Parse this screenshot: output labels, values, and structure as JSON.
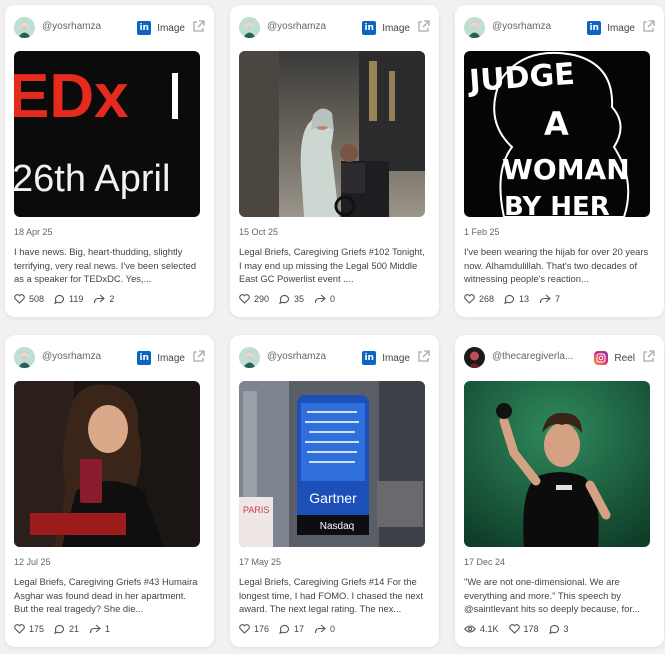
{
  "posts": [
    {
      "handle": "@yosrhamza",
      "platform": "linkedin",
      "platform_glyph": "in",
      "type_label": "Image",
      "date": "18 Apr 25",
      "image_text_line1": "EDx",
      "image_text_line2": "26th April",
      "text": "I have news. Big, heart-thudding, slightly terrifying, very real news. I've been selected as a speaker for TEDxDC. Yes,...",
      "stats": {
        "likes": "508",
        "comments": "119",
        "shares": "2"
      }
    },
    {
      "handle": "@yosrhamza",
      "platform": "linkedin",
      "platform_glyph": "in",
      "type_label": "Image",
      "date": "15 Oct 25",
      "text": "Legal Briefs, Caregiving Griefs #102 Tonight, I may end up missing the Legal 500 Middle East GC Powerlist event ....",
      "stats": {
        "likes": "290",
        "comments": "35",
        "shares": "0"
      }
    },
    {
      "handle": "@yosrhamza",
      "platform": "linkedin",
      "platform_glyph": "in",
      "type_label": "Image",
      "date": "1 Feb 25",
      "image_words": [
        "JUDGE",
        "A",
        "WOMAN",
        "BY HER"
      ],
      "text": "I've been wearing the hijab for over 20 years now. Alhamdulillah. That's two decades of witnessing people's reaction...",
      "stats": {
        "likes": "268",
        "comments": "13",
        "shares": "7"
      }
    },
    {
      "handle": "@yosrhamza",
      "platform": "linkedin",
      "platform_glyph": "in",
      "type_label": "Image",
      "date": "12 Jul 25",
      "text": "Legal Briefs, Caregiving Griefs #43 Humaira Asghar was found dead in her apartment. But the real tragedy? She die...",
      "stats": {
        "likes": "175",
        "comments": "21",
        "shares": "1"
      }
    },
    {
      "handle": "@yosrhamza",
      "platform": "linkedin",
      "platform_glyph": "in",
      "type_label": "Image",
      "date": "17 May 25",
      "image_texts": {
        "gartner": "Gartner",
        "nasdaq": "Nasdaq",
        "paris": "PARIS"
      },
      "text": "Legal Briefs, Caregiving Griefs #14 For the longest time, I had FOMO. I chased the next award. The next legal rating. The nex...",
      "stats": {
        "likes": "176",
        "comments": "17",
        "shares": "0"
      }
    },
    {
      "handle": "@thecaregiverla...",
      "platform": "instagram",
      "platform_glyph": "",
      "type_label": "Reel",
      "date": "17 Dec 24",
      "text": "\"We are not one-dimensional. We are everything and more.\" This speech by @saintlevant hits so deeply because, for...",
      "stats": {
        "views": "4.1K",
        "likes": "178",
        "comments": "3"
      }
    }
  ],
  "colors": {
    "linkedin": "#0a66c2",
    "ted_red": "#e62b1e",
    "reel_green": "#1f6a47"
  }
}
